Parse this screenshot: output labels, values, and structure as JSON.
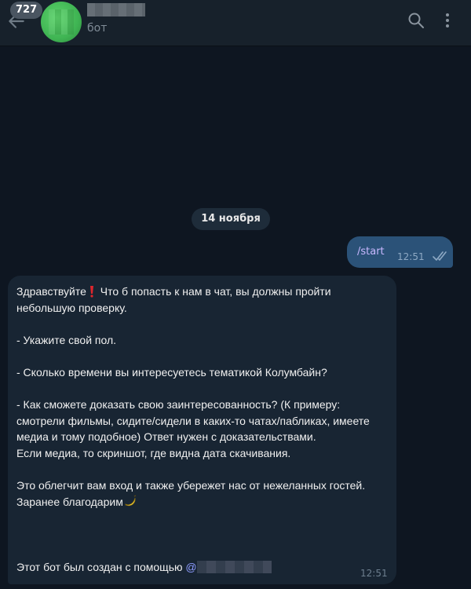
{
  "header": {
    "unread_count": "727",
    "subtitle": "бот",
    "icons": [
      "back-arrow-icon",
      "search-icon",
      "more-vert-icon"
    ]
  },
  "chat": {
    "date_label": "14 ноября",
    "outgoing": {
      "text": "/start",
      "time": "12:51",
      "status": "read"
    },
    "incoming": {
      "greeting": "Здравствуйте",
      "line1_rest": " Что б попасть к нам в чат, вы должны пройти небольшую проверку.",
      "body": "- Укажите свой пол.\n\n- Сколько времени вы интересуетесь тематикой Колумбайн?\n\n- Как сможете доказать свою заинтересованность? (К примеру: смотрели фильмы, сидите/сидели в каких-то чатах/пабликах, имеете медиа и тому подобное) Ответ нужен с доказательствами.\nЕсли медиа, то скриншот, где видна дата скачивания.\n\nЭто облегчит вам вход и также убережет нас от нежеланных гостей.",
      "thanks": "Заранее благодарим",
      "signature": "Этот бот был создан с помощью ",
      "mention_prefix": "@",
      "time": "12:51"
    }
  },
  "colors": {
    "background": "#0e1621",
    "header": "#17212b",
    "outgoing_bubble": "#2b5278",
    "incoming_bubble": "#182533",
    "accent_text": "#c8b8ff"
  }
}
